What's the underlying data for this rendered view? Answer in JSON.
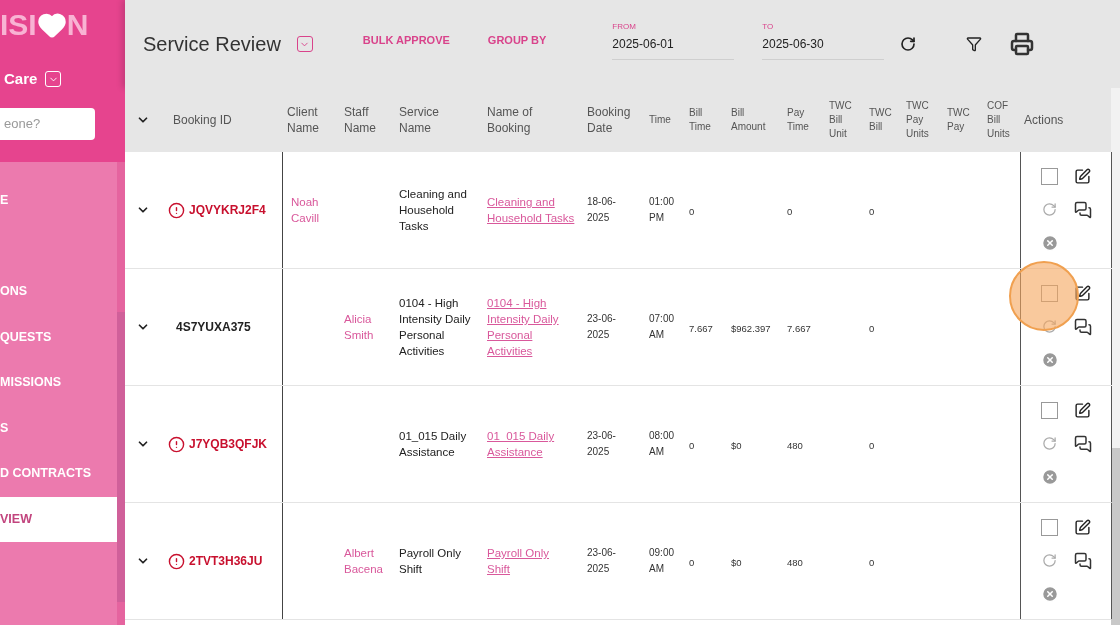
{
  "sidebar": {
    "logo": {
      "left": "ISI",
      "right": "N"
    },
    "org": "Care",
    "search": {
      "placeholder": "eone?"
    },
    "items": [
      {
        "label": "E",
        "selected": false
      },
      {
        "label": "ONS",
        "selected": false
      },
      {
        "label": "QUESTS",
        "selected": false
      },
      {
        "label": "MISSIONS",
        "selected": false
      },
      {
        "label": "S",
        "selected": false
      },
      {
        "label": "D CONTRACTS",
        "selected": false
      },
      {
        "label": "VIEW",
        "selected": true
      }
    ]
  },
  "toolbar": {
    "title": "Service Review",
    "actions": [
      "BULK APPROVE",
      "GROUP BY"
    ],
    "from": {
      "label": "FROM",
      "value": "2025-06-01"
    },
    "to": {
      "label": "TO",
      "value": "2025-06-30"
    }
  },
  "table": {
    "columns": [
      "Booking ID",
      "Client Name",
      "Staff Name",
      "Service Name",
      "Name of Booking",
      "Booking Date",
      "Time",
      "Bill Time",
      "Bill Amount",
      "Pay Time",
      "TWC Bill Unit",
      "TWC Bill",
      "TWC Pay Units",
      "TWC Pay",
      "COF Bill Units",
      "Actions"
    ],
    "rows": [
      {
        "alert": true,
        "booking_id": "JQVYKRJ2F4",
        "client": "Noah Cavill",
        "service": "Cleaning and Household Tasks",
        "booking_name": "Cleaning and Household Tasks",
        "booking_date": "18-06-2025",
        "time": "01:00 PM",
        "bill_time": "0",
        "pay_time": "0",
        "twc_bill": "0",
        "checked": false,
        "highlighted": false
      },
      {
        "alert": false,
        "booking_id": "4S7YUXA375",
        "staff": "Alicia Smith",
        "service": "0104 - High Intensity Daily Personal Activities",
        "booking_name": "0104 - High Intensity Daily Personal Activities",
        "booking_date": "23-06-2025",
        "time": "07:00 AM",
        "bill_time": "7.667",
        "bill_amount": "$962.397",
        "pay_time": "7.667",
        "twc_bill": "0",
        "checked": false,
        "highlighted": true
      },
      {
        "alert": true,
        "booking_id": "J7YQB3QFJK",
        "service": "01_015 Daily Assistance",
        "booking_name": "01_015 Daily Assistance",
        "booking_date": "23-06-2025",
        "time": "08:00 AM",
        "bill_time": "0",
        "bill_amount": "$0",
        "pay_time": "480",
        "twc_bill": "0",
        "checked": false,
        "highlighted": false
      },
      {
        "alert": true,
        "booking_id": "2TVT3H36JU",
        "staff": "Albert Bacena",
        "service": "Payroll Only Shift",
        "booking_name": "Payroll Only Shift",
        "booking_date": "23-06-2025",
        "time": "09:00 AM",
        "bill_time": "0",
        "bill_amount": "$0",
        "pay_time": "480",
        "twc_bill": "0",
        "checked": false,
        "highlighted": false
      }
    ]
  }
}
